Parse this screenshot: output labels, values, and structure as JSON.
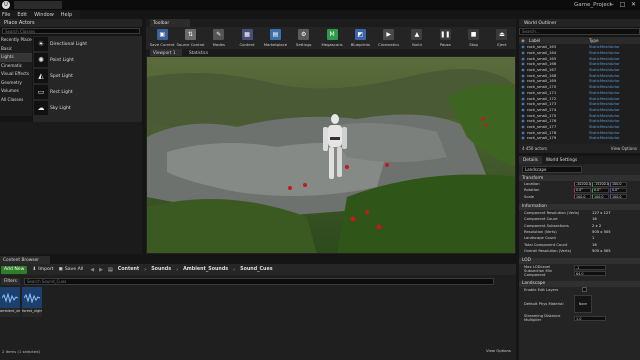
{
  "window": {
    "project_name": "Game_Project",
    "controls": [
      "−",
      "□",
      "✕"
    ]
  },
  "menu": [
    "File",
    "Edit",
    "Window",
    "Help"
  ],
  "modes": {
    "tab_label": "Place Actors",
    "search_placeholder": "Search Classes",
    "categories": [
      "Recently Placed",
      "Basic",
      "Lights",
      "Cinematic",
      "Visual Effects",
      "Geometry",
      "Volumes",
      "All Classes"
    ],
    "selected_category": 2,
    "items": [
      {
        "label": "Directional Light",
        "icon": "directional-light-icon",
        "glyph": "☀"
      },
      {
        "label": "Point Light",
        "icon": "point-light-icon",
        "glyph": "✺"
      },
      {
        "label": "Spot Light",
        "icon": "spot-light-icon",
        "glyph": "◭"
      },
      {
        "label": "Rect Light",
        "icon": "rect-light-icon",
        "glyph": "▭"
      },
      {
        "label": "Sky Light",
        "icon": "sky-light-icon",
        "glyph": "☁"
      }
    ]
  },
  "toolbar": {
    "tab_label": "Toolbar",
    "buttons": [
      {
        "label": "Save Current",
        "icon": "save-icon",
        "color": "#3b5f99",
        "glyph": "▣"
      },
      {
        "label": "Source Control",
        "icon": "source-control-icon",
        "color": "#6b6b6b",
        "glyph": "⇅"
      },
      {
        "label": "Modes",
        "icon": "modes-icon",
        "color": "#555555",
        "glyph": "✎"
      },
      {
        "label": "Content",
        "icon": "content-icon",
        "color": "#4a4f7a",
        "glyph": "▦"
      },
      {
        "label": "Marketplace",
        "icon": "marketplace-icon",
        "color": "#3a6fa8",
        "glyph": "▤"
      },
      {
        "label": "Settings",
        "icon": "settings-icon",
        "color": "#5a5a5a",
        "glyph": "⚙"
      },
      {
        "label": "Megascans",
        "icon": "megascans-icon",
        "color": "#2f9a4a",
        "glyph": "M"
      },
      {
        "label": "Blueprints",
        "icon": "blueprints-icon",
        "color": "#3a63a8",
        "glyph": "◩"
      },
      {
        "label": "Cinematics",
        "icon": "cinematics-icon",
        "color": "#4a4a4a",
        "glyph": "▶"
      },
      {
        "label": "Build",
        "icon": "build-icon",
        "color": "#404040",
        "glyph": "▲"
      },
      {
        "label": "Pause",
        "icon": "pause-icon",
        "color": "#3a3a3a",
        "glyph": "❚❚"
      },
      {
        "label": "Stop",
        "icon": "stop-icon",
        "color": "#3a3a3a",
        "glyph": "■"
      },
      {
        "label": "Eject",
        "icon": "eject-icon",
        "color": "#3a3a3a",
        "glyph": "⏏"
      }
    ]
  },
  "viewport": {
    "tab_label": "Viewport 1",
    "stats_label": "Statistics"
  },
  "outliner": {
    "tab_label": "World Outliner",
    "search_placeholder": "Search...",
    "col_label": "Label",
    "col_type": "Type",
    "rows": [
      {
        "label": "rock_small_163",
        "type": "StaticMeshActor"
      },
      {
        "label": "rock_small_164",
        "type": "StaticMeshActor"
      },
      {
        "label": "rock_small_165",
        "type": "StaticMeshActor"
      },
      {
        "label": "rock_small_166",
        "type": "StaticMeshActor"
      },
      {
        "label": "rock_small_167",
        "type": "StaticMeshActor"
      },
      {
        "label": "rock_small_168",
        "type": "StaticMeshActor"
      },
      {
        "label": "rock_small_169",
        "type": "StaticMeshActor"
      },
      {
        "label": "rock_small_170",
        "type": "StaticMeshActor"
      },
      {
        "label": "rock_small_171",
        "type": "StaticMeshActor"
      },
      {
        "label": "rock_small_172",
        "type": "StaticMeshActor"
      },
      {
        "label": "rock_small_173",
        "type": "StaticMeshActor"
      },
      {
        "label": "rock_small_174",
        "type": "StaticMeshActor"
      },
      {
        "label": "rock_small_175",
        "type": "StaticMeshActor"
      },
      {
        "label": "rock_small_176",
        "type": "StaticMeshActor"
      },
      {
        "label": "rock_small_177",
        "type": "StaticMeshActor"
      },
      {
        "label": "rock_small_178",
        "type": "StaticMeshActor"
      },
      {
        "label": "rock_small_179",
        "type": "StaticMeshActor"
      }
    ],
    "actor_count": "4 450 actors",
    "view_options": "View Options"
  },
  "details": {
    "tab_label": "Details",
    "world_settings_label": "World Settings",
    "selected_name": "Landscape",
    "transform": {
      "title": "Transform",
      "location_label": "Location",
      "location": [
        "-20200.0",
        "-15200.0",
        "100.0"
      ],
      "rotation_label": "Rotation",
      "rotation": [
        "0.0°",
        "0.0°",
        "0.0°"
      ],
      "scale_label": "Scale",
      "scale": [
        "100.0",
        "100.0",
        "100.0"
      ]
    },
    "information": {
      "title": "Information",
      "rows": [
        {
          "label": "Component Resolution (Verts)",
          "value": "127 x 127"
        },
        {
          "label": "Component Count",
          "value": "16"
        },
        {
          "label": "Component Subsections",
          "value": "2 x 2"
        },
        {
          "label": "Resolution (Verts)",
          "value": "505 x 505"
        },
        {
          "label": "Landscape Count",
          "value": "1"
        },
        {
          "label": "Total Component Count",
          "value": "16"
        },
        {
          "label": "Overall Resolution (Verts)",
          "value": "505 x 505"
        }
      ]
    },
    "lod": {
      "title": "LOD",
      "rows": [
        {
          "label": "Max LODLevel",
          "value": "-1"
        },
        {
          "label": "Subsection Min Component",
          "value": "64.0"
        }
      ]
    },
    "landscape": {
      "title": "Landscape",
      "rows": [
        {
          "label": "Enable Edit Layers",
          "value": ""
        },
        {
          "label": "Default Phys Material",
          "value": "None"
        },
        {
          "label": "Streaming Distance Multiplier",
          "value": "1.0"
        }
      ]
    }
  },
  "content_browser": {
    "tab_label": "Content Browser",
    "add_new": "Add New",
    "import": "Import",
    "save_all": "Save All",
    "breadcrumb": [
      "Content",
      "Sounds",
      "Ambient_Sounds",
      "Sound_Cues"
    ],
    "filters": "Filters",
    "search_placeholder": "Search Sound_Cues",
    "assets": [
      "ambient_day",
      "forest_night"
    ],
    "status": "2 items (1 selected)",
    "view_options": "View Options"
  }
}
